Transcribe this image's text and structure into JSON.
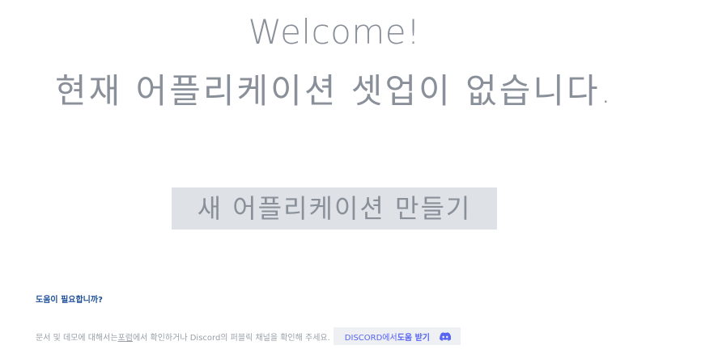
{
  "hero": {
    "welcome": "Welcome!",
    "no_app_message": "현재 어플리케이션 셋업이 없습니다."
  },
  "actions": {
    "create_app_label": "새 어플리케이션 만들기"
  },
  "help": {
    "title": "도움이 필요합니까?",
    "text_before_link": "문서 및 데모에 대해서는 ",
    "forum_link": "포럼",
    "text_after_link": "에서 확인하거나 Discord의 퍼블릭 채널을 확인해 주세요.",
    "discord_prefix": "DISCORD에서 ",
    "discord_strong": "도움 받기",
    "discord_icon": "discord-icon"
  },
  "colors": {
    "heading_gray": "#8a9099",
    "button_bg": "#dee1e5",
    "help_title_blue": "#1f4f99",
    "discord_blurple": "#5865f2"
  }
}
